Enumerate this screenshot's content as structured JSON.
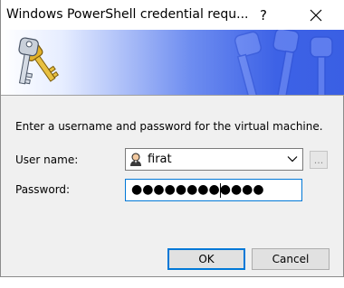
{
  "window": {
    "title": "Windows PowerShell credential requ...",
    "help_label": "?"
  },
  "banner": {
    "icon": "keys-icon",
    "accent_color": "#3d62e6"
  },
  "form": {
    "instruction": "Enter a username and password for the virtual machine.",
    "username_label": "User name:",
    "username_value": "firat",
    "browse_label": "...",
    "password_label": "Password:",
    "password_masked": "●●●●●●●●●●●●"
  },
  "buttons": {
    "ok_label": "OK",
    "cancel_label": "Cancel"
  }
}
